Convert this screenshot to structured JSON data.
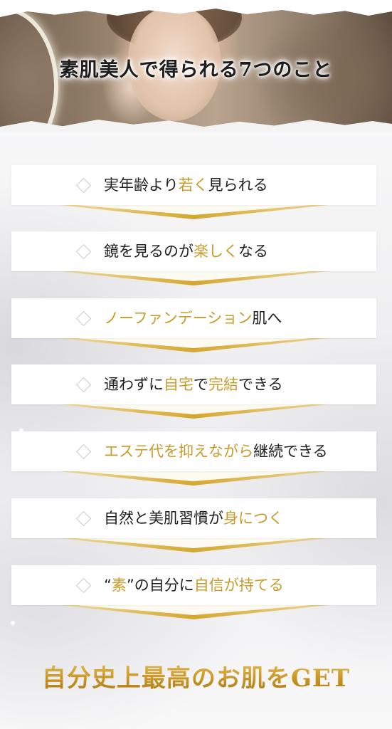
{
  "hero": {
    "title": "素肌美人で得られる7つのこと"
  },
  "colors": {
    "gold": "#c89b2a",
    "text": "#1f1f1f",
    "card": "#ffffff",
    "background": "#f1f1f3"
  },
  "benefits": [
    {
      "parts": [
        {
          "text": "実年齢より",
          "gold": false
        },
        {
          "text": "若く",
          "gold": true
        },
        {
          "text": "見られる",
          "gold": false
        }
      ]
    },
    {
      "parts": [
        {
          "text": "鏡を見るのが",
          "gold": false
        },
        {
          "text": "楽しく",
          "gold": true
        },
        {
          "text": "なる",
          "gold": false
        }
      ]
    },
    {
      "parts": [
        {
          "text": "ノーファンデーション",
          "gold": true
        },
        {
          "text": "肌へ",
          "gold": false
        }
      ]
    },
    {
      "parts": [
        {
          "text": "通わずに",
          "gold": false
        },
        {
          "text": "自宅",
          "gold": true
        },
        {
          "text": "で",
          "gold": false
        },
        {
          "text": "完結",
          "gold": true
        },
        {
          "text": "できる",
          "gold": false
        }
      ]
    },
    {
      "parts": [
        {
          "text": "エステ代を抑えながら",
          "gold": true
        },
        {
          "text": "継続できる",
          "gold": false
        }
      ]
    },
    {
      "parts": [
        {
          "text": "自然と美肌習慣が",
          "gold": false
        },
        {
          "text": "身につく",
          "gold": true
        }
      ]
    },
    {
      "parts": [
        {
          "text": "“",
          "gold": false
        },
        {
          "text": "素",
          "gold": true
        },
        {
          "text": "”の自分に",
          "gold": false
        },
        {
          "text": "自信が持てる",
          "gold": true
        }
      ]
    }
  ],
  "footer": {
    "title": "自分史上最高のお肌をGET"
  },
  "icons": {
    "bullet": "diamond-outline-icon"
  }
}
